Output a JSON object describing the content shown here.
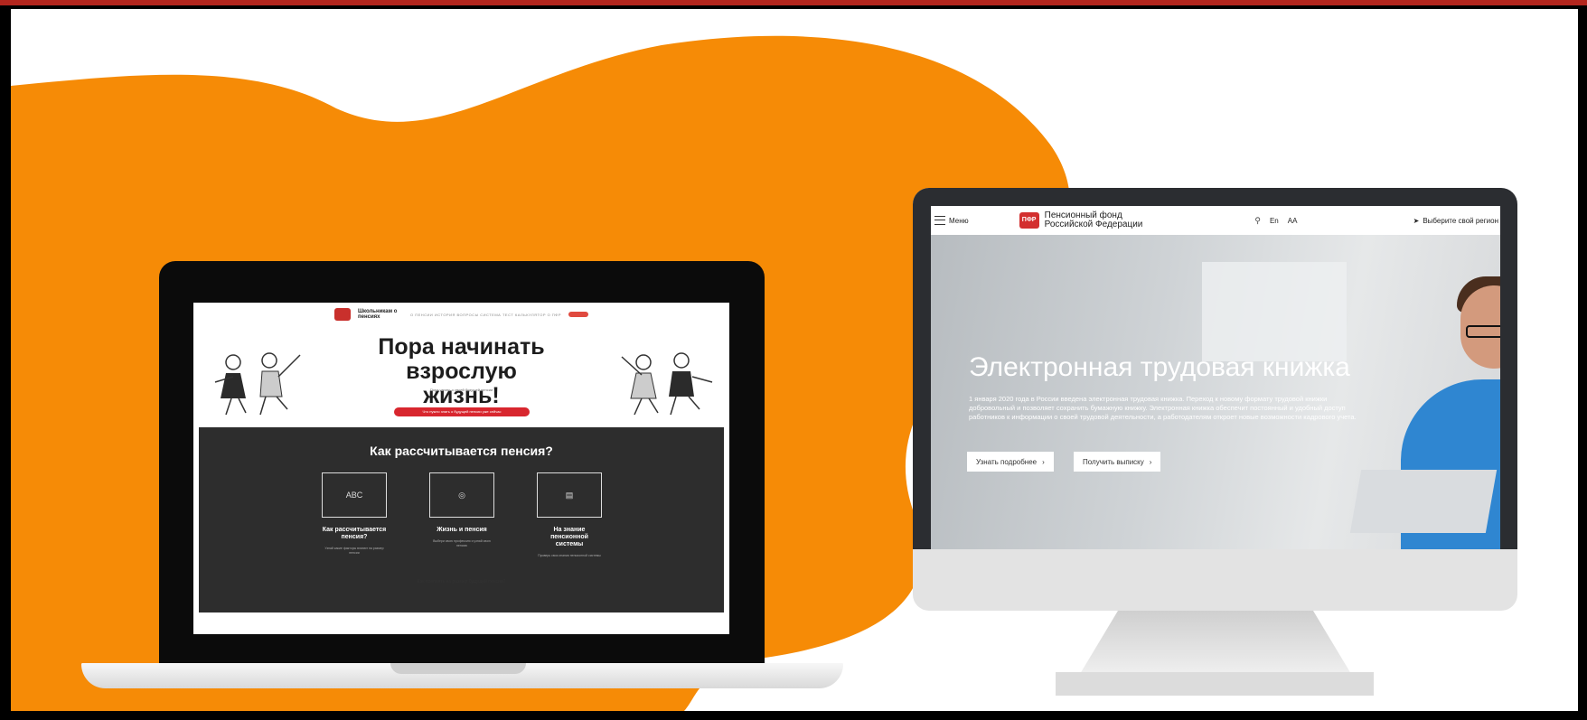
{
  "laptop_site": {
    "brand": "Школьникам о пенсиях",
    "nav": "О ПЕНСИИ  ИСТОРИЯ  ВОПРОСЫ  СИСТЕМА  ТЕСТ  КАЛЬКУЛЯТОР  О ПФР",
    "hero_title": "Пора начинать взрослую жизнь!",
    "hero_subtitle": "Пора узнать о своей будущей пенсии",
    "cta": "Что нужно знать о будущей пенсии уже сейчас",
    "section_title": "Как рассчитывается пенсия?",
    "cards": [
      {
        "icon": "ABC",
        "title": "Как рассчитывается пенсия?",
        "text": "Узнай какие факторы влияют на размер пенсии"
      },
      {
        "icon": "◎",
        "title": "Жизнь и пенсия",
        "text": "Выбери свою профессию и узнай свою пенсию"
      },
      {
        "icon": "▤",
        "title": "На знание пенсионной системы",
        "text": "Проверь свои знания пенсионной системы"
      }
    ],
    "footer_question": "Как повлиять на размер будущей пенсии?"
  },
  "monitor_site": {
    "menu_label": "Меню",
    "logo_text": "ПФР",
    "brand_line1": "Пенсионный фонд",
    "brand_line2": "Российской Федерации",
    "search_icon_glyph": "⚲",
    "lang": "En",
    "font_size": "AA",
    "region_icon_glyph": "➤",
    "region": "Выберите свой регион",
    "hero_title": "Электронная трудовая книжка",
    "hero_text": "1 января 2020 года в России введена электронная трудовая книжка. Переход к новому формату трудовой книжки добровольный и позволяет сохранить бумажную книжку. Электронная книжка обеспечит постоянный и удобный доступ работников к информации о своей трудовой деятельности, а работодателям откроет новые возможности кадрового учета.",
    "btn_more": "Узнать подробнее",
    "btn_extract": "Получить выписку",
    "chevron": "›"
  },
  "colors": {
    "accent_orange": "#f68b06",
    "brand_red": "#d32f2f",
    "dark_section": "#2d2d2d"
  }
}
